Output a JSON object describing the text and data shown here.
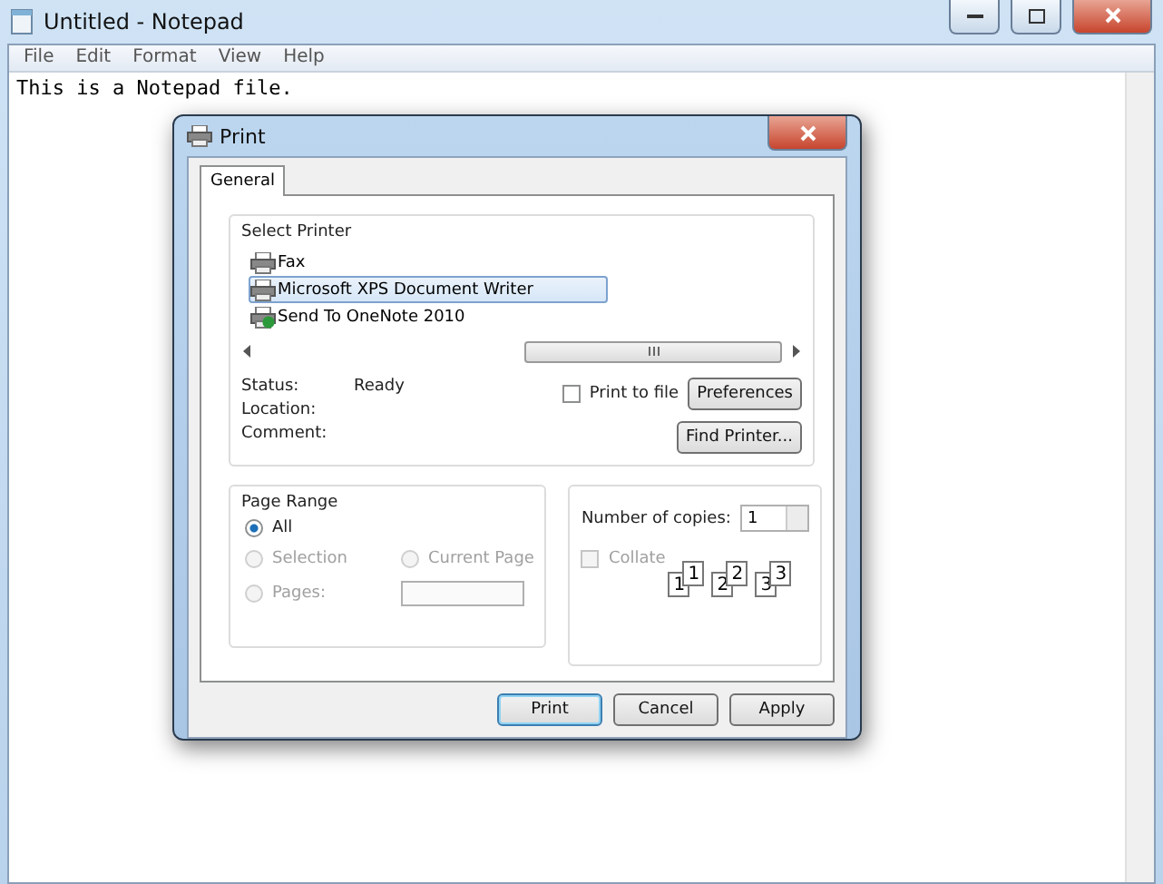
{
  "window": {
    "title": "Untitled - Notepad"
  },
  "menu": [
    "File",
    "Edit",
    "Format",
    "View",
    "Help"
  ],
  "document": {
    "text": "This is a Notepad file."
  },
  "dialog": {
    "title": "Print",
    "tabs": [
      {
        "label": "General",
        "selected": true
      }
    ],
    "select_printer": {
      "label": "Select Printer",
      "printers": [
        {
          "name": "Fax",
          "selected": false,
          "default": false
        },
        {
          "name": "Microsoft XPS Document Writer",
          "selected": true,
          "default": false
        },
        {
          "name": "Send To OneNote 2010",
          "selected": false,
          "default": true
        }
      ],
      "status_label": "Status:",
      "status": "Ready",
      "location_label": "Location:",
      "comment_label": "Comment:",
      "print_to_file": {
        "label": "Print to file",
        "checked": false
      },
      "preferences": "Preferences",
      "find_printer": "Find Printer..."
    },
    "page_range": {
      "label": "Page Range",
      "options": [
        {
          "label": "All",
          "selected": true,
          "disabled": false
        },
        {
          "label": "Selection",
          "selected": false,
          "disabled": true
        },
        {
          "label": "Current Page",
          "selected": false,
          "disabled": true
        },
        {
          "label": "Pages:",
          "selected": false,
          "disabled": true
        }
      ]
    },
    "copies": {
      "label": "Number of copies:",
      "value": "1",
      "collate": {
        "label": "Collate",
        "checked": false,
        "disabled": true
      },
      "collate_stacks": [
        {
          "back": "1",
          "front": "1"
        },
        {
          "back": "2",
          "front": "2"
        },
        {
          "back": "3",
          "front": "3"
        }
      ]
    },
    "buttons": [
      {
        "label": "Print",
        "default": true
      },
      {
        "label": "Cancel",
        "default": false
      },
      {
        "label": "Apply",
        "default": false
      }
    ]
  }
}
